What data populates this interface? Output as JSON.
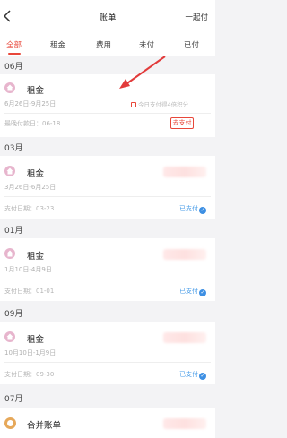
{
  "header": {
    "back_icon": "chevron-left-icon",
    "title": "账单",
    "right_action": "一起付"
  },
  "tabs": [
    {
      "label": "全部",
      "active": true
    },
    {
      "label": "租金",
      "active": false
    },
    {
      "label": "费用",
      "active": false
    },
    {
      "label": "未付",
      "active": false
    },
    {
      "label": "已付",
      "active": false
    }
  ],
  "bills": [
    {
      "month": "06月",
      "title": "租金",
      "period": "6月26日-9月25日",
      "date_label": "最晚付款日：06-18",
      "promo": "今日支付得4倍积分",
      "action": "去支付"
    },
    {
      "month": "03月",
      "title": "租金",
      "period": "3月26日-6月25日",
      "date_label": "支付日期：03-23",
      "status": "已支付"
    },
    {
      "month": "01月",
      "title": "租金",
      "period": "1月10日-4月9日",
      "date_label": "支付日期：01-01",
      "status": "已支付"
    },
    {
      "month": "09月",
      "title": "租金",
      "period": "10月10日-1月9日",
      "date_label": "支付日期：09-30",
      "status": "已支付"
    },
    {
      "month": "07月",
      "title": "合并账单"
    }
  ],
  "colors": {
    "accent": "#e8473a",
    "paid": "#3d8fe3",
    "icon_pink": "#e7b5cd",
    "icon_orange": "#e6a85a"
  }
}
